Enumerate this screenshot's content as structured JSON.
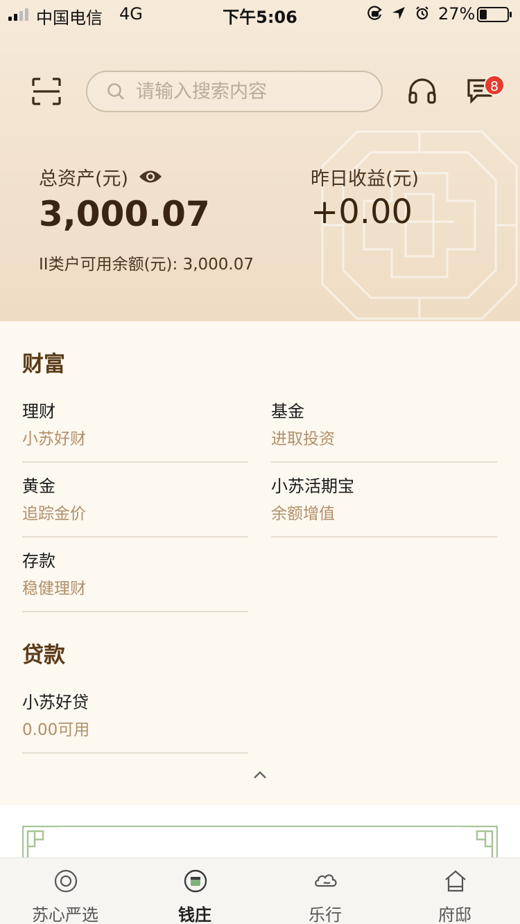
{
  "status_bar": {
    "carrier": "中国电信",
    "network": "4G",
    "time": "下午5:06",
    "battery_percent": "27%",
    "battery_level": 0.27,
    "icons": [
      "orientation-lock-icon",
      "location-arrow-icon",
      "alarm-icon"
    ]
  },
  "header": {
    "search_placeholder": "请输入搜索内容",
    "message_count": "8",
    "icons": [
      "scan-icon",
      "search-icon",
      "headset-icon",
      "message-icon"
    ]
  },
  "assets": {
    "total_label": "总资产(元)",
    "total_value": "3,000.07",
    "yesterday_label": "昨日收益(元)",
    "yesterday_value": "+0.00",
    "account_line": "II类户可用余额(元): 3,000.07"
  },
  "wealth": {
    "title": "财富",
    "items": [
      {
        "name": "理财",
        "desc": "小苏好财"
      },
      {
        "name": "基金",
        "desc": "进取投资"
      },
      {
        "name": "黄金",
        "desc": "追踪金价"
      },
      {
        "name": "小苏活期宝",
        "desc": "余额增值"
      },
      {
        "name": "存款",
        "desc": "稳健理财"
      }
    ]
  },
  "loan": {
    "title": "贷款",
    "items": [
      {
        "name": "小苏好贷",
        "desc": "0.00可用"
      }
    ]
  },
  "tabbar": {
    "active": "钱庄",
    "tabs": [
      {
        "label": "苏心严选",
        "icon": "select-icon"
      },
      {
        "label": "钱庄",
        "icon": "bank-icon"
      },
      {
        "label": "乐行",
        "icon": "cloud-icon"
      },
      {
        "label": "府邸",
        "icon": "home-icon"
      }
    ]
  },
  "colors": {
    "brand_brown": "#5a3a18",
    "desc_gold": "#b18f6a",
    "badge_red": "#e53a2e",
    "active_green": "#7fb27a"
  }
}
